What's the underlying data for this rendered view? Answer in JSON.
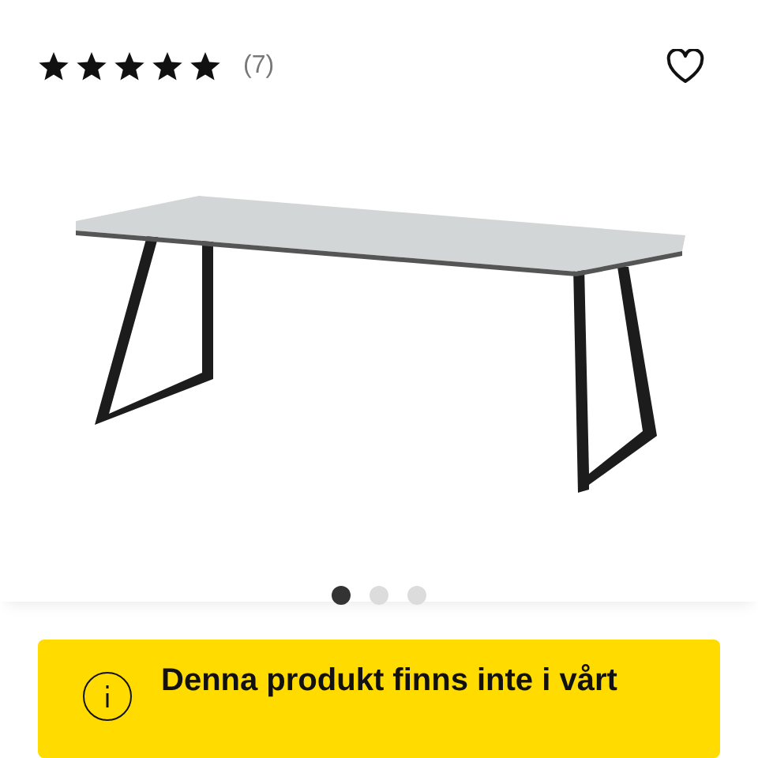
{
  "rating": {
    "stars": 5,
    "count": "(7)"
  },
  "favorite": {
    "selected": false
  },
  "gallery": {
    "dots": [
      {
        "selected": true
      },
      {
        "selected": false
      },
      {
        "selected": false
      }
    ]
  },
  "notice": {
    "text": "Denna produkt finns inte i vårt"
  }
}
